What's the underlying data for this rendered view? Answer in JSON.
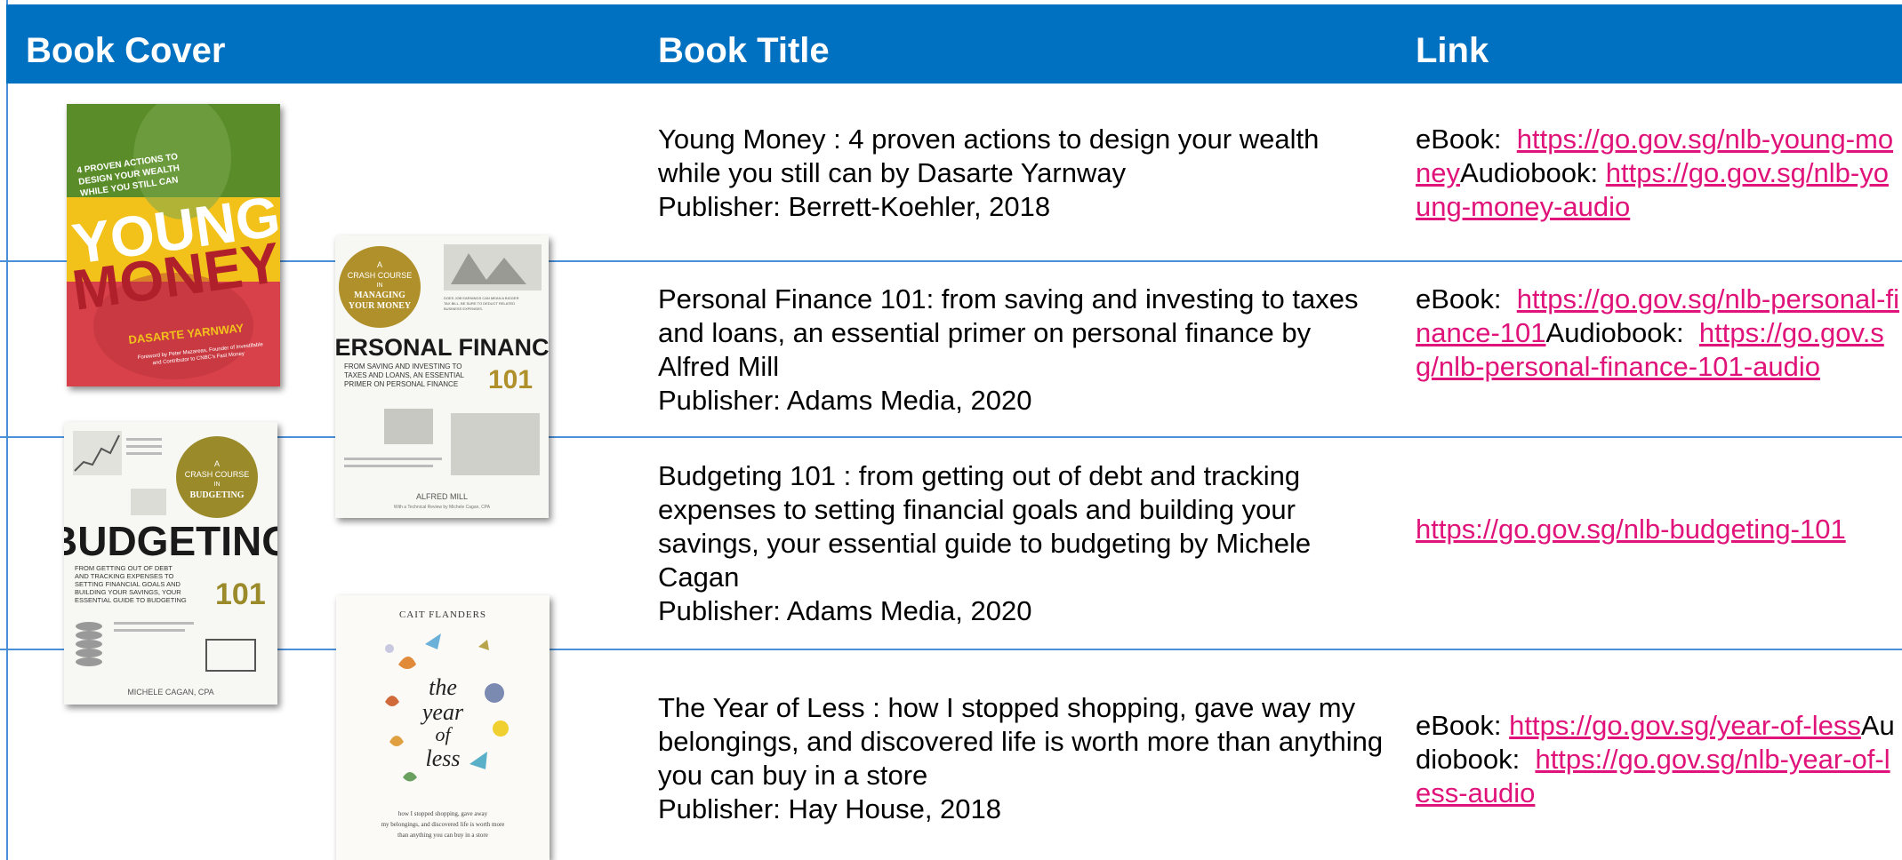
{
  "header": {
    "cover": "Book Cover",
    "title": "Book Title",
    "link": "Link"
  },
  "books": [
    {
      "title": "Young Money : 4 proven actions to design your wealth while you still can by Dasarte Yarnway",
      "publisher": "Publisher: Berrett-Koehler, 2018",
      "ebook_label": "eBook:",
      "ebook_url": "https://go.gov.sg/nlb-young-money",
      "audio_label": "Audiobook:",
      "audio_url": "https://go.gov.sg/nlb-young-money-audio"
    },
    {
      "title": "Personal Finance 101: from saving and investing to taxes and loans, an essential primer on personal finance by Alfred Mill",
      "publisher": "Publisher: Adams Media, 2020",
      "ebook_label": "eBook:",
      "ebook_url": "https://go.gov.sg/nlb-personal-finance-101",
      "audio_label": "Audiobook:",
      "audio_url": "https://go.gov.sg/nlb-personal-finance-101-audio"
    },
    {
      "title": "Budgeting 101 : from getting out of debt and tracking expenses to setting financial goals and building your savings, your essential guide to budgeting by Michele Cagan",
      "publisher": "Publisher: Adams Media, 2020",
      "url": "https://go.gov.sg/nlb-budgeting-101"
    },
    {
      "title": "The Year of Less : how I stopped shopping, gave way my belongings, and discovered life is worth more than anything you can buy in a store",
      "publisher": "Publisher: Hay House, 2018",
      "ebook_label": "eBook:",
      "ebook_url": "https://go.gov.sg/year-of-less",
      "audio_label": "Audiobook:",
      "audio_url": "https://go.gov.sg/nlb-year-of-less-audio"
    }
  ],
  "covers": {
    "young_money": {
      "tagline": "4 PROVEN ACTIONS TO DESIGN YOUR WEALTH WHILE YOU STILL CAN",
      "word1": "YOUNG",
      "word2": "MONEY",
      "author": "DASARTE YARNWAY",
      "foreword": "Foreword by Peter Mazareas, Founder of Investifable and Contributor to CNBC's Fast Money",
      "colors": {
        "green": "#5a8c2a",
        "yellow": "#f2c21b",
        "red": "#d8404a"
      }
    },
    "personal_finance": {
      "badge_top": "A CRASH COURSE IN",
      "badge_main": "MANAGING YOUR MONEY",
      "title": "PERSONAL FINANCE",
      "number": "101",
      "subtitle": "FROM SAVING AND INVESTING TO TAXES AND LOANS, AN ESSENTIAL PRIMER ON PERSONAL FINANCE",
      "author": "ALFRED MILL",
      "review": "With a Technical Review by Michele Cagan, CPA",
      "colors": {
        "badge": "#b0902a"
      }
    },
    "budgeting": {
      "badge_top": "A CRASH COURSE IN",
      "badge_main": "BUDGETING",
      "title": "BUDGETING",
      "number": "101",
      "subtitle": "FROM GETTING OUT OF DEBT AND TRACKING EXPENSES TO SETTING FINANCIAL GOALS AND BUILDING YOUR SAVINGS, YOUR ESSENTIAL GUIDE TO BUDGETING",
      "author": "MICHELE CAGAN, CPA",
      "colors": {
        "badge": "#9a8a2a"
      }
    },
    "year_of_less": {
      "author": "CAIT FLANDERS",
      "title_lines": [
        "the",
        "year",
        "of",
        "less"
      ],
      "tagline": "how I stopped shopping, gave away my belongings, and discovered life is worth more than anything you can buy in a store"
    }
  },
  "colors": {
    "header_bg": "#0070c0",
    "grid": "#4a90d9",
    "link": "#e0137a"
  }
}
